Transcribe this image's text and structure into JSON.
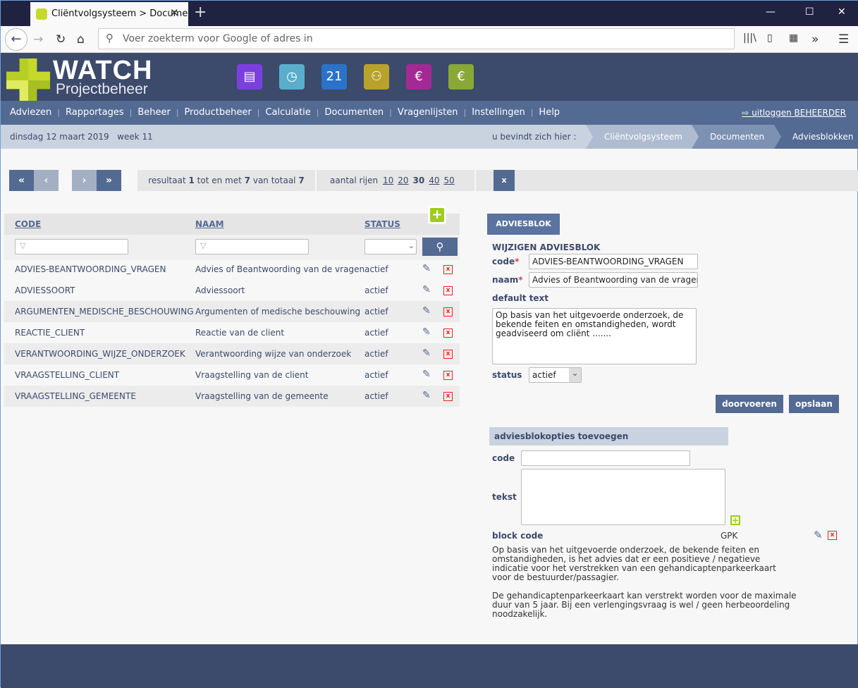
{
  "browser": {
    "tab_title": "Cliëntvolgsysteem > Documenten",
    "url_placeholder": "Voer zoekterm voor Google of adres in"
  },
  "header": {
    "brand": "WATCH",
    "subbrand": "Projectbeheer",
    "apps": [
      {
        "icon": "documents-icon",
        "color": "#7b3fe0"
      },
      {
        "icon": "clock-icon",
        "color": "#5aaecb"
      },
      {
        "icon": "calendar-icon",
        "color": "#2a73c9"
      },
      {
        "icon": "people-icon",
        "color": "#b8a22c"
      },
      {
        "icon": "invoice-euro-icon",
        "color": "#a32a94"
      },
      {
        "icon": "calculator-euro-icon",
        "color": "#8aa838"
      }
    ]
  },
  "nav": {
    "items": [
      "Adviezen",
      "Rapportages",
      "Beheer",
      "Productbeheer",
      "Calculatie",
      "Documenten",
      "Vragenlijsten",
      "Instellingen",
      "Help"
    ],
    "logout": "uitloggen BEHEERDER"
  },
  "breadcrumb": {
    "date": "dinsdag 12 maart 2019",
    "week": "week 11",
    "label": "u bevindt zich hier :",
    "items": [
      "Cliëntvolgsysteem",
      "Documenten",
      "Adviesblokken"
    ]
  },
  "pager": {
    "first": "«",
    "prev": "‹",
    "next": "›",
    "last": "»",
    "result_prefix": "resultaat",
    "from": "1",
    "mid": "tot en met",
    "to": "7",
    "total_label": "van totaal",
    "total": "7",
    "rows_label": "aantal rijen",
    "row_options": [
      "10",
      "20",
      "30",
      "40",
      "50"
    ],
    "selected_rows": "30",
    "export_icon": "excel-export-icon"
  },
  "table": {
    "headers": {
      "code": "CODE",
      "naam": "NAAM",
      "status": "STATUS"
    },
    "rows": [
      {
        "code": "ADVIES-BEANTWOORDING_VRAGEN",
        "naam": "Advies of Beantwoording van de vragen",
        "status": "actief"
      },
      {
        "code": "ADVIESSOORT",
        "naam": "Adviessoort",
        "status": "actief"
      },
      {
        "code": "ARGUMENTEN_MEDISCHE_BESCHOUWING",
        "naam": "Argumenten of medische beschouwing",
        "status": "actief"
      },
      {
        "code": "REACTIE_CLIENT",
        "naam": "Reactie van de client",
        "status": "actief"
      },
      {
        "code": "VERANTWOORDING_WIJZE_ONDERZOEK",
        "naam": "Verantwoording wijze van onderzoek",
        "status": "actief"
      },
      {
        "code": "VRAAGSTELLING_CLIENT",
        "naam": "Vraagstelling van de client",
        "status": "actief"
      },
      {
        "code": "VRAAGSTELLING_GEMEENTE",
        "naam": "Vraagstelling van de gemeente",
        "status": "actief"
      }
    ]
  },
  "form": {
    "tab": "ADVIESBLOK",
    "title": "WIJZIGEN ADVIESBLOK",
    "code_label": "code",
    "naam_label": "naam",
    "required": "*",
    "code_value": "ADVIES-BEANTWOORDING_VRAGEN",
    "naam_value": "Advies of Beantwoording van de vragen",
    "default_label": "default text",
    "default_value": "Op basis van het uitgevoerde onderzoek, de bekende feiten en omstandigheden, wordt geadviseerd om cliënt .......",
    "status_label": "status",
    "status_value": "actief",
    "apply": "doorvoeren",
    "save": "opslaan"
  },
  "options": {
    "title": "adviesblokopties toevoegen",
    "code_label": "code",
    "tekst_label": "tekst",
    "block_label": "block code",
    "block_value": "GPK",
    "block_text1": "Op basis van het uitgevoerde onderzoek, de bekende feiten en omstandigheden, is het advies dat er een positieve / negatieve indicatie voor het verstrekken van een gehandicaptenparkeerkaart voor de bestuurder/passagier.",
    "block_text2": "De gehandicaptenparkeerkaart kan verstrekt worden voor de maximale duur van 5 jaar. Bij een verlengingsvraag is wel / geen herbeoordeling noodzakelijk."
  }
}
